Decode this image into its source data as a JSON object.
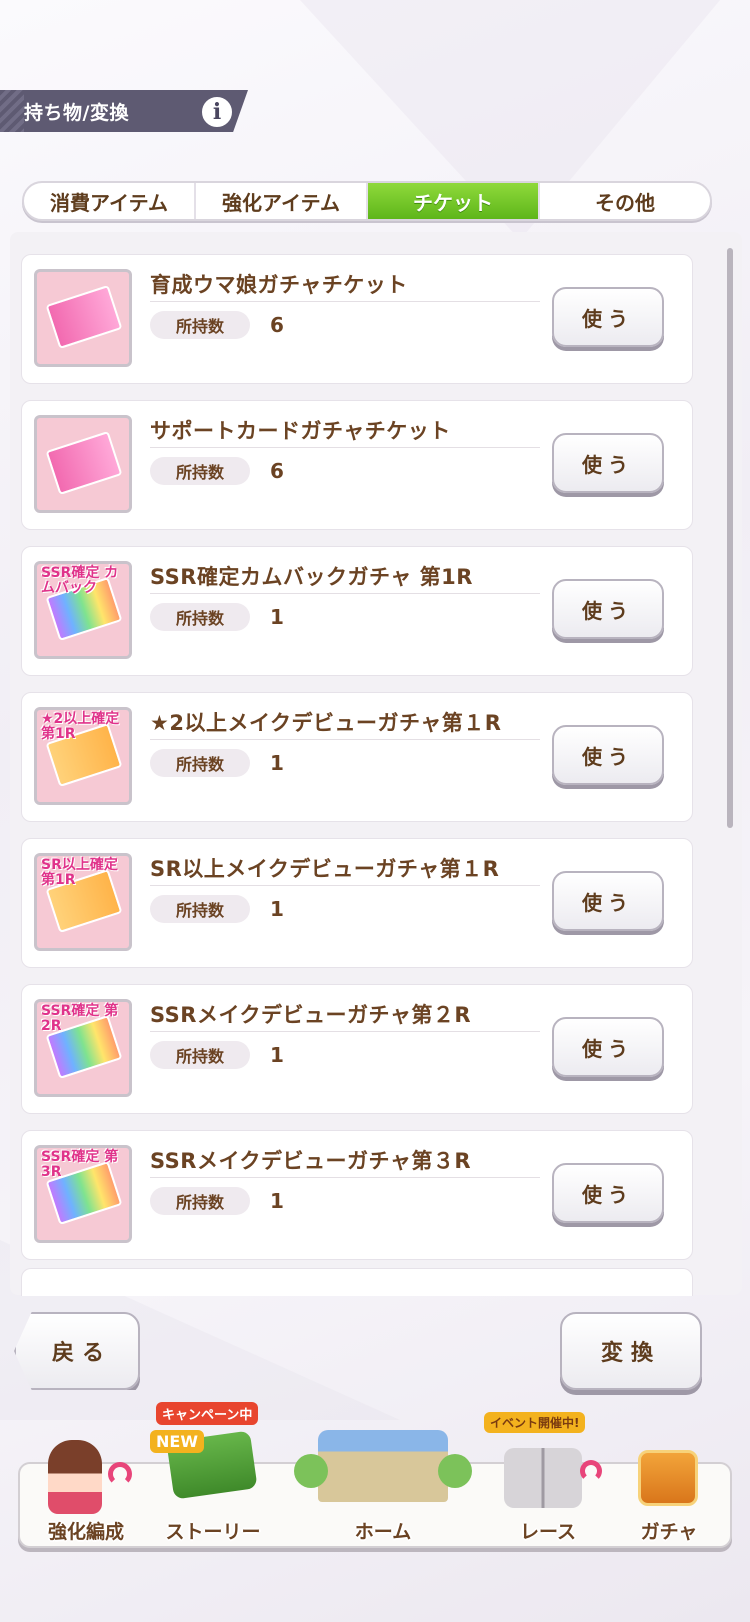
{
  "header": {
    "title": "持ち物/変換",
    "info_icon": "i"
  },
  "tabs": [
    {
      "label": "消費アイテム",
      "active": false
    },
    {
      "label": "強化アイテム",
      "active": false
    },
    {
      "label": "チケット",
      "active": true
    },
    {
      "label": "その他",
      "active": false
    }
  ],
  "items": [
    {
      "name": "育成ウマ娘ガチャチケット",
      "qty_label": "所持数",
      "qty": "6",
      "use_label": "使う",
      "icon": "pink-horse-ticket-icon",
      "icon_text": ""
    },
    {
      "name": "サポートカードガチャチケット",
      "qty_label": "所持数",
      "qty": "6",
      "use_label": "使う",
      "icon": "pink-support-ticket-icon",
      "icon_text": ""
    },
    {
      "name": "SSR確定カムバックガチャ 第1R",
      "qty_label": "所持数",
      "qty": "1",
      "use_label": "使う",
      "icon": "rainbow-ticket-icon",
      "icon_text": "SSR確定 カムバック"
    },
    {
      "name": "★2以上メイクデビューガチャ第１R",
      "qty_label": "所持数",
      "qty": "1",
      "use_label": "使う",
      "icon": "orange-ticket-icon",
      "icon_text": "★2以上確定 第1R"
    },
    {
      "name": "SR以上メイクデビューガチャ第１R",
      "qty_label": "所持数",
      "qty": "1",
      "use_label": "使う",
      "icon": "orange-ticket-icon",
      "icon_text": "SR以上確定 第1R"
    },
    {
      "name": "SSRメイクデビューガチャ第２R",
      "qty_label": "所持数",
      "qty": "1",
      "use_label": "使う",
      "icon": "rainbow-ticket-icon",
      "icon_text": "SSR確定 第2R"
    },
    {
      "name": "SSRメイクデビューガチャ第３R",
      "qty_label": "所持数",
      "qty": "1",
      "use_label": "使う",
      "icon": "rainbow-ticket-icon",
      "icon_text": "SSR確定 第3R"
    }
  ],
  "buttons": {
    "back": "戻る",
    "convert": "変換"
  },
  "nav": [
    {
      "label": "強化編成",
      "icon": "character-portrait-icon",
      "badge": ""
    },
    {
      "label": "ストーリー",
      "icon": "story-book-icon",
      "badge": "キャンペーン中",
      "badge2": "NEW"
    },
    {
      "label": "ホーム",
      "icon": "school-building-icon",
      "badge": ""
    },
    {
      "label": "レース",
      "icon": "race-gate-icon",
      "badge": "イベント開催中!"
    },
    {
      "label": "ガチャ",
      "icon": "gacha-door-icon",
      "badge": ""
    }
  ],
  "colors": {
    "accent_green": "#6cc424",
    "text_brown": "#6b4323",
    "header_bg": "#5e5a72",
    "icon_pink": "#f6c9d4"
  }
}
